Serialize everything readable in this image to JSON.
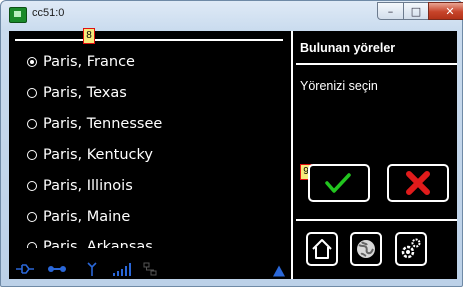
{
  "window": {
    "title": "cc51:0",
    "controls": {
      "minimize": "–",
      "maximize": "□",
      "close": "✕"
    }
  },
  "list": {
    "items": [
      {
        "label": "Paris, France",
        "selected": true
      },
      {
        "label": "Paris, Texas",
        "selected": false
      },
      {
        "label": "Paris, Tennessee",
        "selected": false
      },
      {
        "label": "Paris, Kentucky",
        "selected": false
      },
      {
        "label": "Paris, Illinois",
        "selected": false
      },
      {
        "label": "Paris, Maine",
        "selected": false
      },
      {
        "label": "Paris, Arkansas",
        "selected": false
      }
    ]
  },
  "panel": {
    "title": "Bulunan yöreler",
    "prompt": "Yörenizi seçin"
  },
  "buttons": {
    "ok_icon": "checkmark-icon",
    "cancel_icon": "red-x-icon",
    "home_icon": "home-icon",
    "globe_icon": "globe-icon",
    "settings_icon": "gears-icon"
  },
  "annotations": {
    "marker_1": "8",
    "marker_2": "9"
  },
  "status_icons": [
    "plug-icon",
    "network-icon",
    "antenna-icon",
    "signal-bars-icon",
    "lan-icon",
    "scroll-up-arrow-icon"
  ],
  "colors": {
    "background": "#000000",
    "foreground": "#ffffff",
    "ok": "#22c51f",
    "cancel": "#e01b1b",
    "status": "#2a67d8"
  }
}
